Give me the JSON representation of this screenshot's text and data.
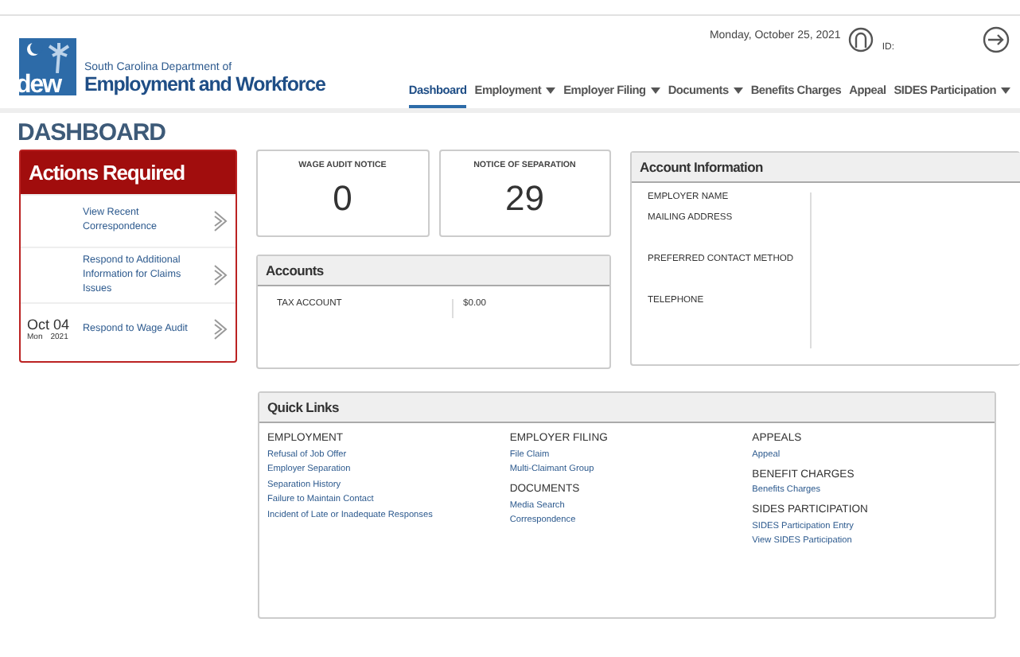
{
  "header": {
    "agency_line": "South Carolina Department of",
    "agency_name": "Employment and Workforce",
    "logo_text": "dew",
    "date": "Monday, October 25, 2021",
    "id_label": "ID:"
  },
  "nav": [
    {
      "label": "Dashboard",
      "selected": true,
      "dropdown": false
    },
    {
      "label": "Employment",
      "selected": false,
      "dropdown": true
    },
    {
      "label": "Employer Filing",
      "selected": false,
      "dropdown": true
    },
    {
      "label": "Documents",
      "selected": false,
      "dropdown": true
    },
    {
      "label": "Benefits Charges",
      "selected": false,
      "dropdown": false
    },
    {
      "label": "Appeal",
      "selected": false,
      "dropdown": false
    },
    {
      "label": "SIDES Participation",
      "selected": false,
      "dropdown": true
    }
  ],
  "page_title": "DASHBOARD",
  "actions": {
    "title": "Actions Required",
    "items": [
      {
        "label": "View Recent Correspondence"
      },
      {
        "label": "Respond to Additional Information for Claims Issues"
      },
      {
        "label": "Respond to Wage Audit",
        "date": "Oct 04",
        "day": "Mon",
        "year": "2021"
      }
    ]
  },
  "notices": [
    {
      "title": "WAGE AUDIT NOTICE",
      "count": "0"
    },
    {
      "title": "NOTICE OF SEPARATION",
      "count": "29"
    }
  ],
  "accounts": {
    "title": "Accounts",
    "rows": [
      {
        "label": "TAX ACCOUNT",
        "value": "$0.00"
      }
    ]
  },
  "account_info": {
    "title": "Account Information",
    "fields": [
      "EMPLOYER NAME",
      "MAILING ADDRESS",
      "PREFERRED CONTACT METHOD",
      "TELEPHONE"
    ]
  },
  "quick_links": {
    "title": "Quick Links",
    "columns": [
      [
        {
          "heading": "EMPLOYMENT",
          "links": [
            "Refusal of Job Offer",
            "Employer Separation",
            "Separation History",
            "Failure to Maintain Contact",
            "Incident of Late or Inadequate Responses"
          ]
        }
      ],
      [
        {
          "heading": "EMPLOYER FILING",
          "links": [
            "File Claim",
            "Multi-Claimant Group"
          ]
        },
        {
          "heading": "DOCUMENTS",
          "links": [
            "Media Search",
            "Correspondence"
          ]
        }
      ],
      [
        {
          "heading": "APPEALS",
          "links": [
            "Appeal"
          ]
        },
        {
          "heading": "BENEFIT CHARGES",
          "links": [
            "Benefits Charges"
          ]
        },
        {
          "heading": "SIDES PARTICIPATION",
          "links": [
            "SIDES Participation Entry",
            "View SIDES Participation"
          ]
        }
      ]
    ]
  }
}
